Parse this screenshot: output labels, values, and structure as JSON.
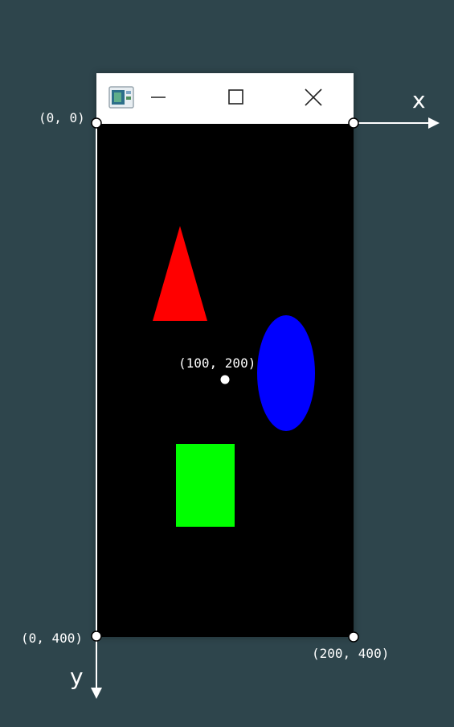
{
  "window": {
    "controls": {
      "minimize": "minimize-icon",
      "maximize": "maximize-icon",
      "close": "close-icon"
    }
  },
  "axes": {
    "x_label": "x",
    "y_label": "y"
  },
  "coordinates": {
    "top_left": "(0, 0)",
    "center": "(100, 200)",
    "bottom_left": "(0, 400)",
    "bottom_right": "(200, 400)"
  },
  "shapes": {
    "triangle": {
      "color": "#ff0000"
    },
    "ellipse": {
      "color": "#0000ff"
    },
    "rectangle": {
      "color": "#00ff00"
    }
  },
  "colors": {
    "background": "#2e454c",
    "window_client": "#000000",
    "titlebar": "#ffffff",
    "axis": "#ffffff"
  }
}
